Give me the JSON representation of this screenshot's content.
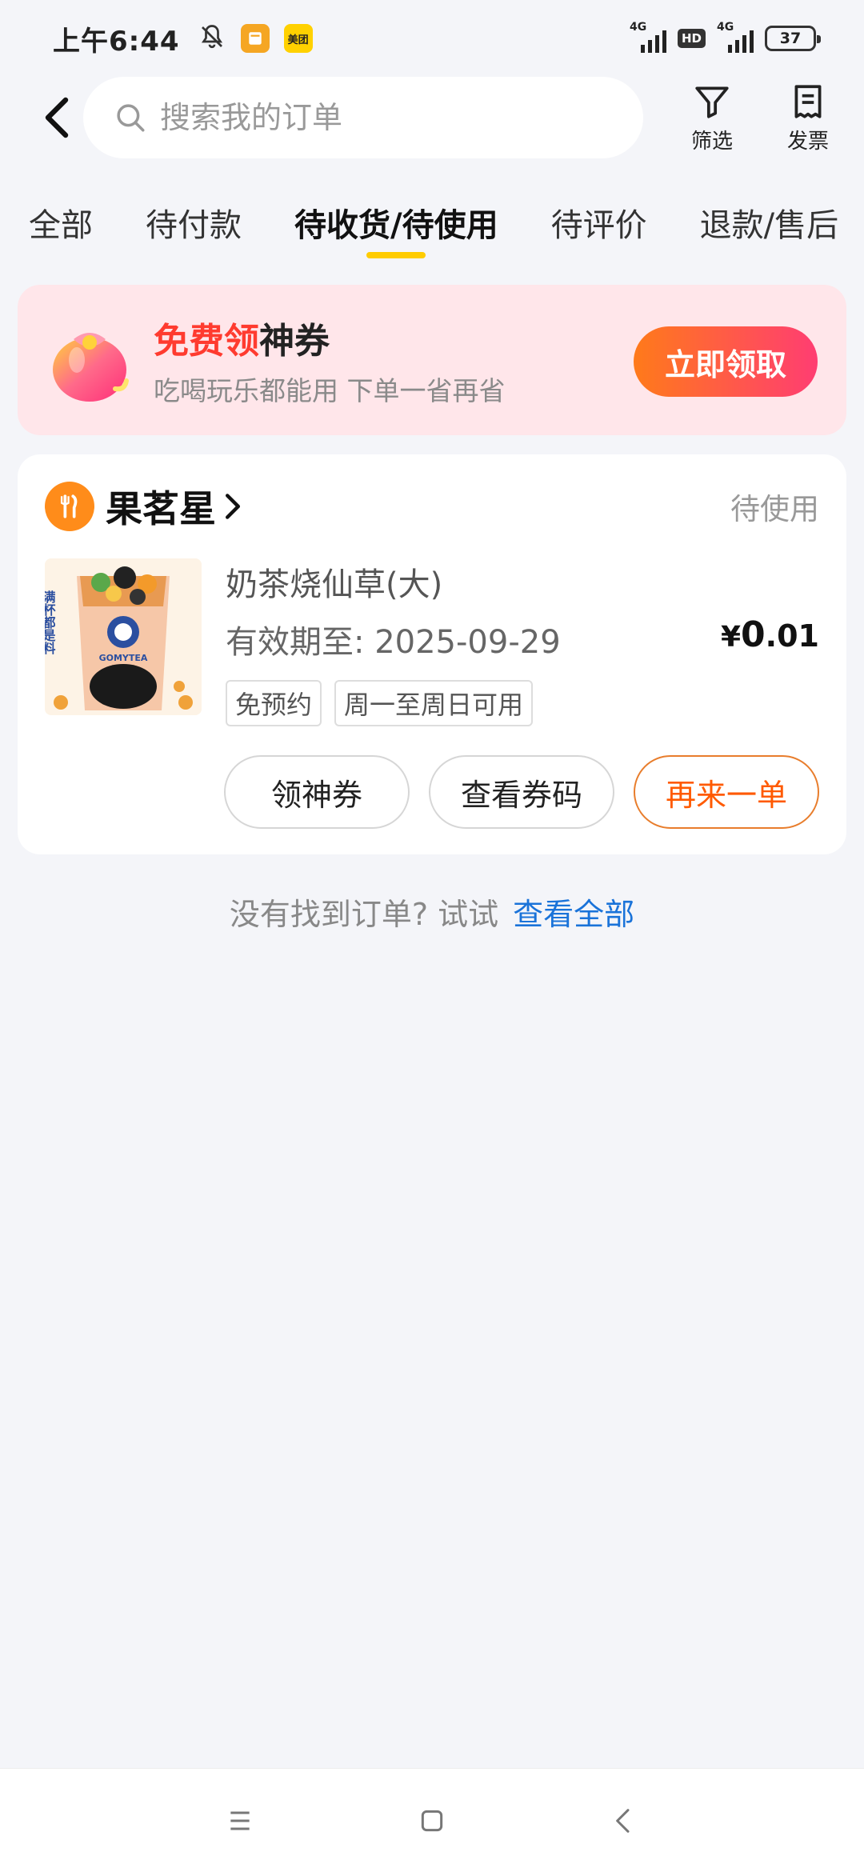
{
  "status_bar": {
    "time": "上午6:44",
    "meituan_badge": "美团",
    "network1": "4G",
    "hd": "HD",
    "network2": "4G",
    "battery": "37"
  },
  "header": {
    "search_placeholder": "搜索我的订单",
    "filter_label": "筛选",
    "invoice_label": "发票"
  },
  "tabs": [
    {
      "label": "全部",
      "active": false
    },
    {
      "label": "待付款",
      "active": false
    },
    {
      "label": "待收货/待使用",
      "active": true
    },
    {
      "label": "待评价",
      "active": false
    },
    {
      "label": "退款/售后",
      "active": false
    }
  ],
  "banner": {
    "title_red": "免费领",
    "title_black": "神券",
    "subtitle": "吃喝玩乐都能用 下单一省再省",
    "button": "立即领取"
  },
  "order": {
    "store_name": "果茗星",
    "status": "待使用",
    "product_name": "奶茶烧仙草(大)",
    "valid_until": "有效期至: 2025-09-29",
    "tags": [
      "免预约",
      "周一至周日可用"
    ],
    "price_symbol": "¥",
    "price_int": "0",
    "price_dec": ".01",
    "image_text_side": "满杯都是料",
    "image_brand": "GOMYTEA",
    "buttons": [
      "领神券",
      "查看券码",
      "再来一单"
    ]
  },
  "footer": {
    "not_found_text": "没有找到订单? 试试",
    "link": "查看全部"
  },
  "colors": {
    "accent_yellow": "#ffcc00",
    "banner_bg": "#ffe6ea",
    "claim_gradient_start": "#ff7a1a",
    "claim_gradient_end": "#ff3d72",
    "link_blue": "#1a73d9",
    "reorder_orange": "#ff5a00"
  }
}
